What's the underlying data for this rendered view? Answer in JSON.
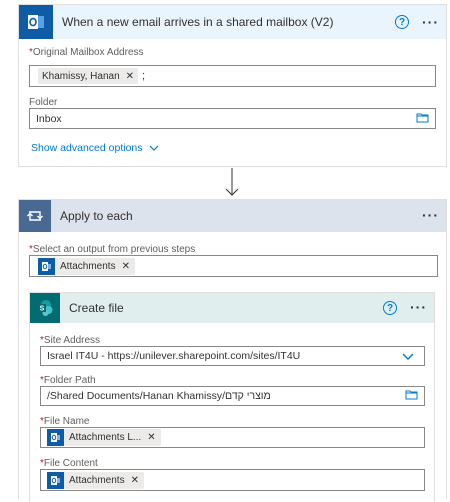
{
  "trigger": {
    "title": "When a new email arrives in a shared mailbox (V2)",
    "mailbox_label": "Original Mailbox Address",
    "mailbox_token": "Khamissy, Hanan",
    "mailbox_suffix": ";",
    "folder_label": "Folder",
    "folder_value": "Inbox",
    "advanced_link": "Show advanced options",
    "help_glyph": "?",
    "more_glyph": "···"
  },
  "apply_each": {
    "title": "Apply to each",
    "select_label": "Select an output from previous steps",
    "select_token": "Attachments",
    "more_glyph": "···"
  },
  "create_file": {
    "title": "Create file",
    "site_label": "Site Address",
    "site_value": "Israel IT4U - https://unilever.sharepoint.com/sites/IT4U",
    "folder_label": "Folder Path",
    "folder_value": "/Shared Documents/Hanan Khamissy/מוצרי קדם",
    "name_label": "File Name",
    "name_token": "Attachments L...",
    "content_label": "File Content",
    "content_token": "Attachments",
    "help_glyph": "?",
    "more_glyph": "···"
  },
  "required_mark": "*",
  "colors": {
    "trigger_header": "#eaf4fc",
    "apply_header": "#dde3ec",
    "apply_icon_bg": "#486991",
    "create_header": "#e0efee",
    "create_icon_bg": "#036c70",
    "outlook_blue": "#0f5ca6",
    "link_blue": "#0078d4"
  }
}
